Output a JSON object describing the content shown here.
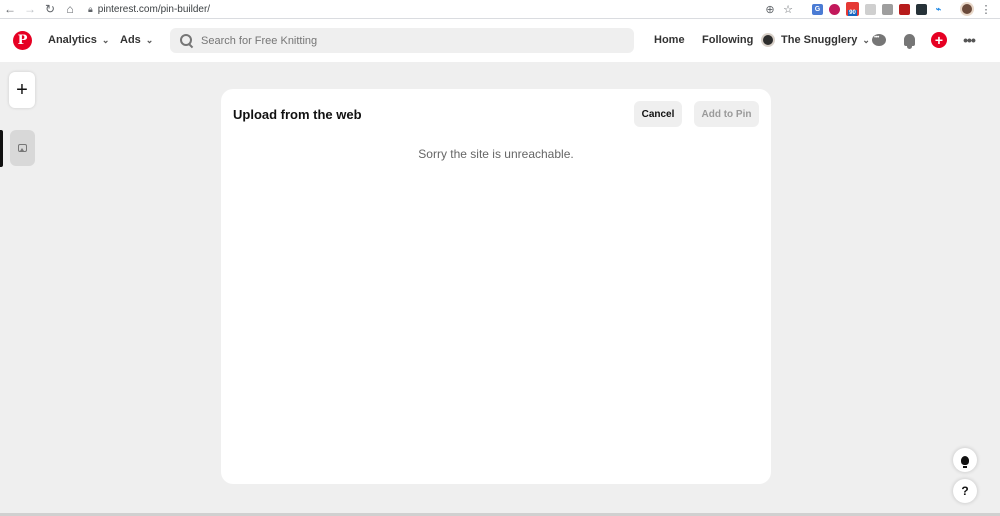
{
  "browser": {
    "url": "pinterest.com/pin-builder/",
    "extensions": [
      "translate-icon",
      "pink-extension-icon",
      "todo-badge-icon",
      "grey-extension-icon",
      "pdf-icon",
      "adobe-icon",
      "qr-icon",
      "bird-icon"
    ],
    "ext_badge": "90"
  },
  "header": {
    "logo": "P",
    "menu": [
      {
        "label": "Analytics"
      },
      {
        "label": "Ads"
      }
    ],
    "search_placeholder": "Search for Free Knitting",
    "nav": {
      "home": "Home",
      "following": "Following",
      "profile": "The Snugglery"
    },
    "add_label": "+",
    "more_label": "•••"
  },
  "rail": {
    "add_label": "+"
  },
  "card": {
    "title": "Upload from the web",
    "cancel_label": "Cancel",
    "add_to_pin_label": "Add to Pin",
    "message": "Sorry the site is unreachable."
  },
  "help": {
    "question_label": "?"
  },
  "colors": {
    "brand": "#e60023",
    "background": "#efefef"
  }
}
